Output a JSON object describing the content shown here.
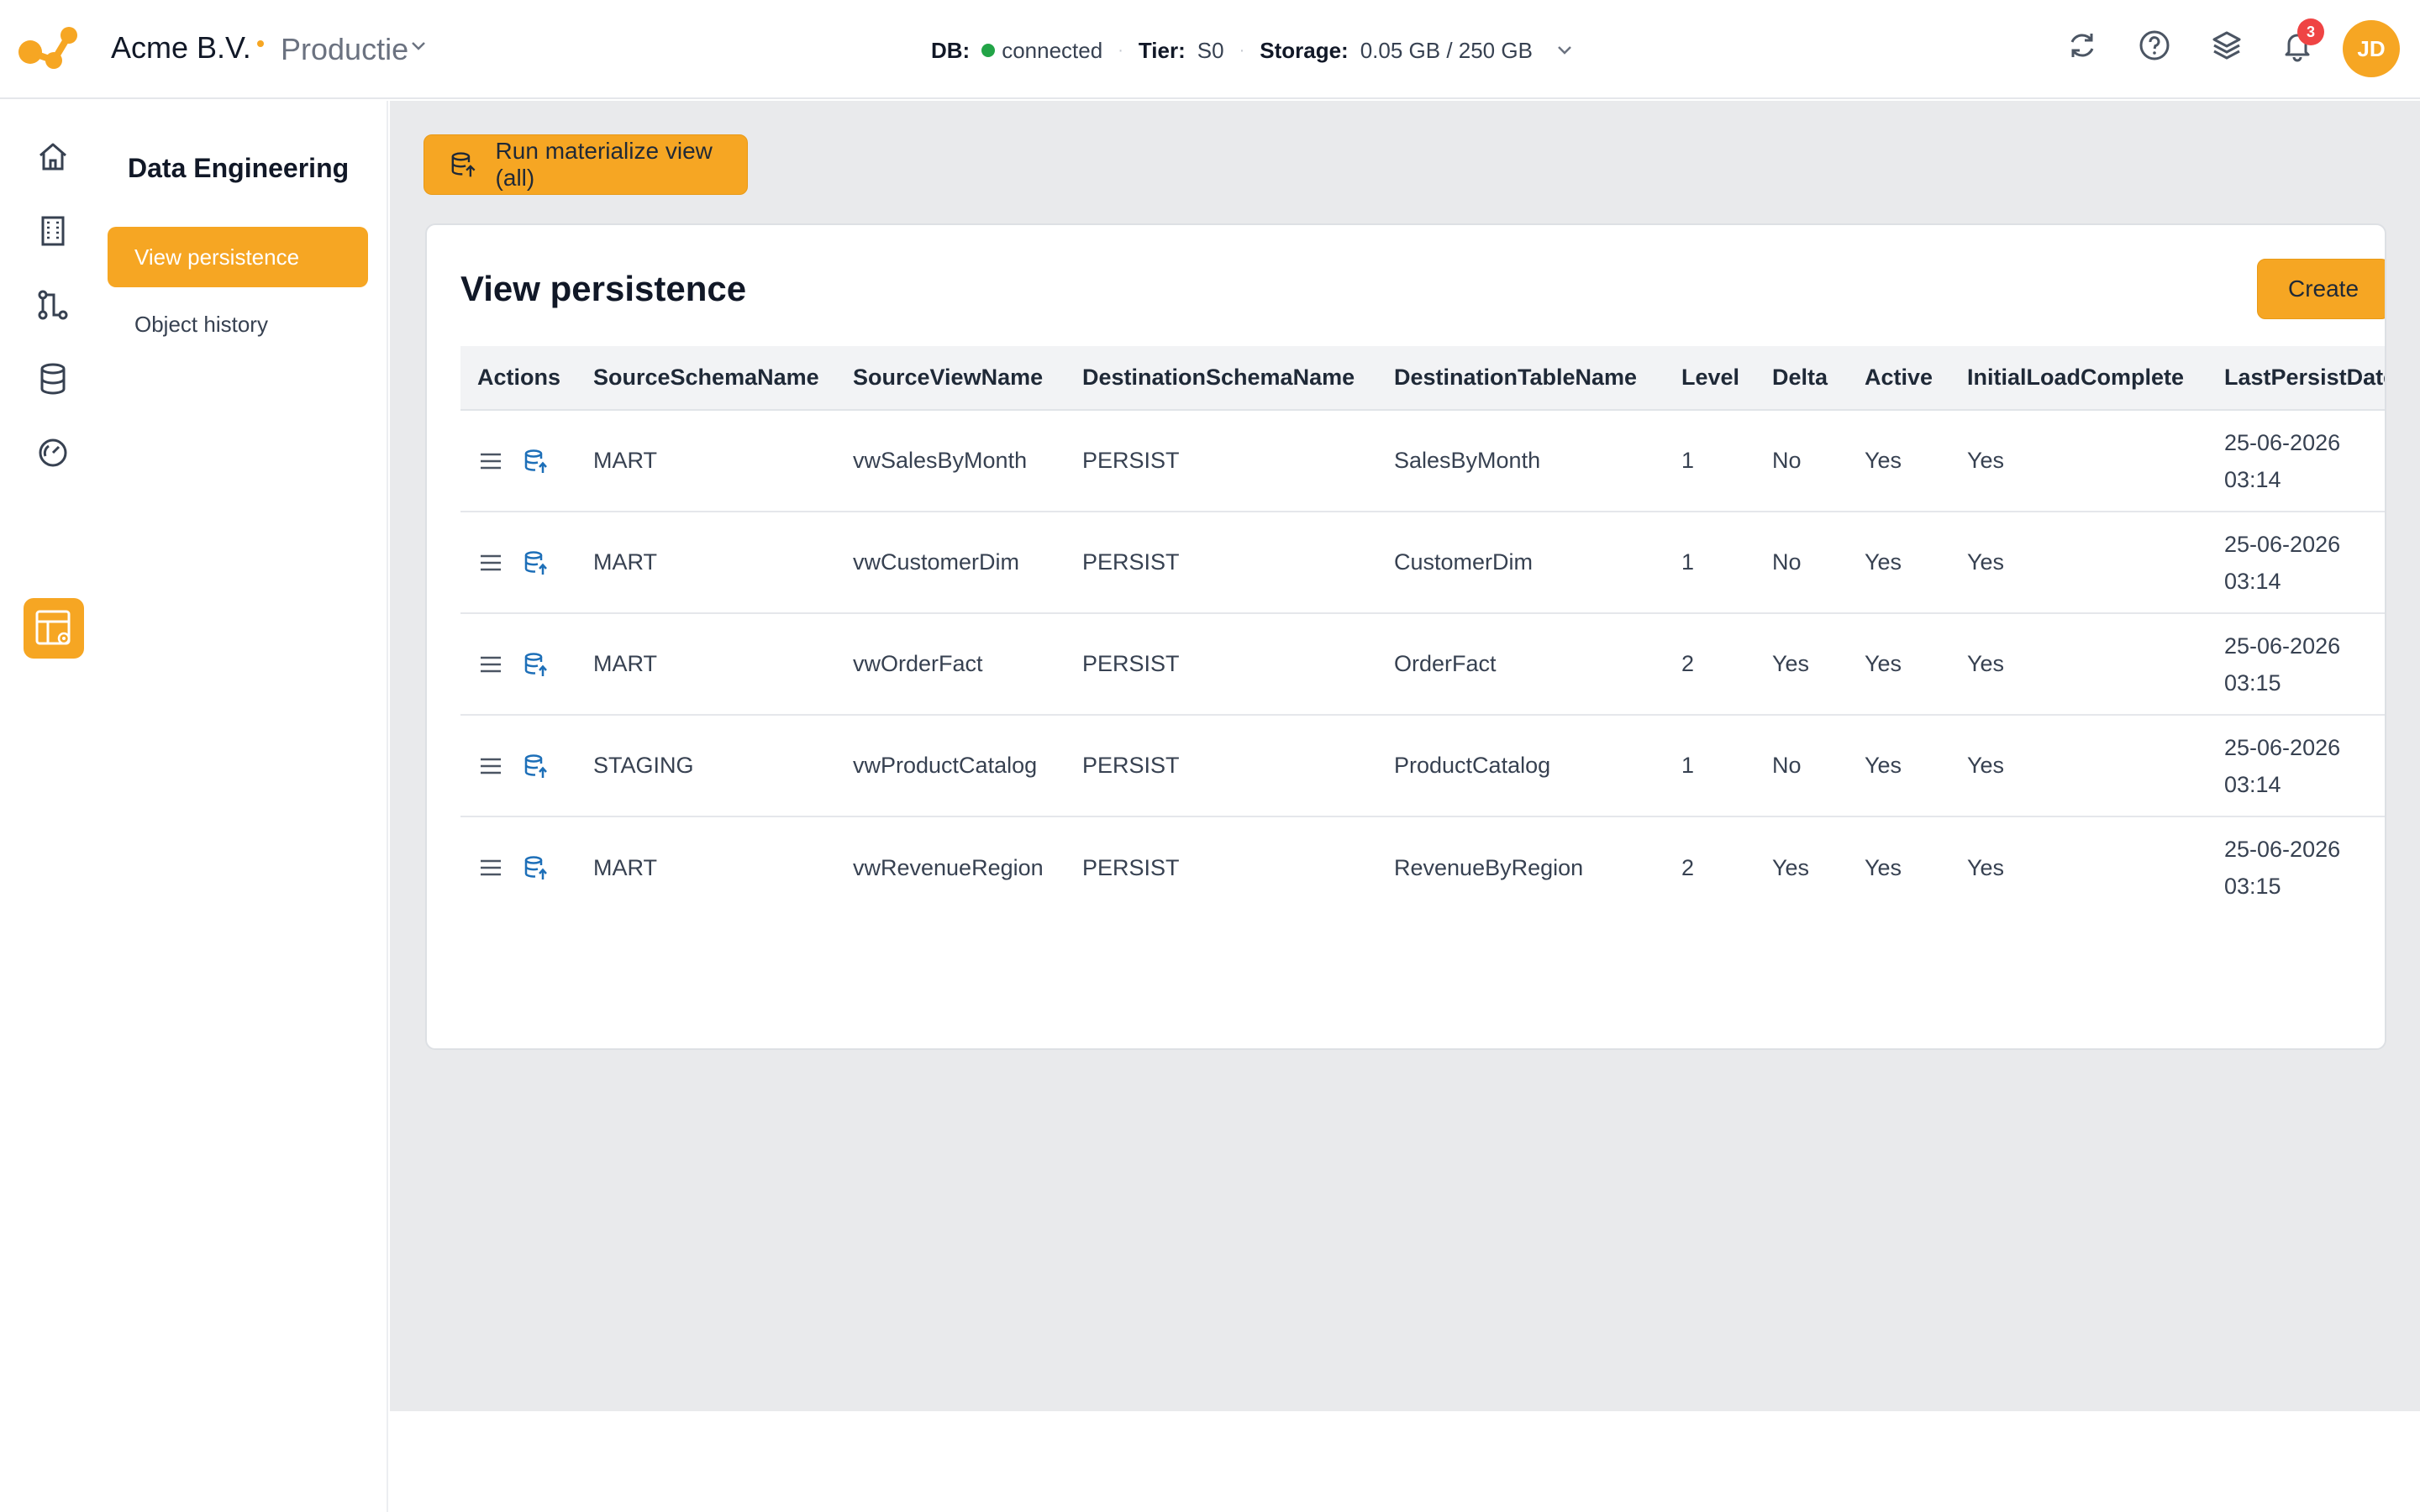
{
  "header": {
    "org_name": "Acme B.V.",
    "environment": "Productie",
    "db_label": "DB:",
    "db_status": "connected",
    "tier_label": "Tier:",
    "tier_value": "S0",
    "storage_label": "Storage:",
    "storage_value": "0.05 GB / 250 GB",
    "notification_count": "3",
    "avatar_initials": "JD"
  },
  "colors": {
    "accent": "#f6a623",
    "status_connected": "#22a447",
    "yes_green": "#16a34a",
    "badge_red": "#ef4444"
  },
  "rail": {
    "icons": [
      "home-icon",
      "building-icon",
      "workflow-icon",
      "database-icon",
      "gauge-icon",
      "table-settings-icon"
    ],
    "active": "table-settings-icon"
  },
  "sidebar": {
    "title": "Data Engineering",
    "items": [
      {
        "label": "View persistence",
        "active": true
      },
      {
        "label": "Object history",
        "active": false
      }
    ]
  },
  "toolbar": {
    "run_label": "Run materialize view (all)"
  },
  "card": {
    "title": "View persistence",
    "create_label": "Create"
  },
  "table": {
    "columns": [
      "Actions",
      "SourceSchemaName",
      "SourceViewName",
      "DestinationSchemaName",
      "DestinationTableName",
      "Level",
      "Delta",
      "Active",
      "InitialLoadComplete",
      "LastPersistDate"
    ],
    "rows": [
      {
        "source_schema": "MART",
        "source_view": "vwSalesByMonth",
        "dest_schema": "PERSIST",
        "dest_table": "SalesByMonth",
        "level": "1",
        "delta": "No",
        "active": "Yes",
        "initial_load": "Yes",
        "date": "25-06-2026",
        "time": "03:14"
      },
      {
        "source_schema": "MART",
        "source_view": "vwCustomerDim",
        "dest_schema": "PERSIST",
        "dest_table": "CustomerDim",
        "level": "1",
        "delta": "No",
        "active": "Yes",
        "initial_load": "Yes",
        "date": "25-06-2026",
        "time": "03:14"
      },
      {
        "source_schema": "MART",
        "source_view": "vwOrderFact",
        "dest_schema": "PERSIST",
        "dest_table": "OrderFact",
        "level": "2",
        "delta": "Yes",
        "active": "Yes",
        "initial_load": "Yes",
        "date": "25-06-2026",
        "time": "03:15"
      },
      {
        "source_schema": "STAGING",
        "source_view": "vwProductCatalog",
        "dest_schema": "PERSIST",
        "dest_table": "ProductCatalog",
        "level": "1",
        "delta": "No",
        "active": "Yes",
        "initial_load": "Yes",
        "date": "25-06-2026",
        "time": "03:14"
      },
      {
        "source_schema": "MART",
        "source_view": "vwRevenueRegion",
        "dest_schema": "PERSIST",
        "dest_table": "RevenueByRegion",
        "level": "2",
        "delta": "Yes",
        "active": "Yes",
        "initial_load": "Yes",
        "date": "25-06-2026",
        "time": "03:15"
      }
    ]
  }
}
